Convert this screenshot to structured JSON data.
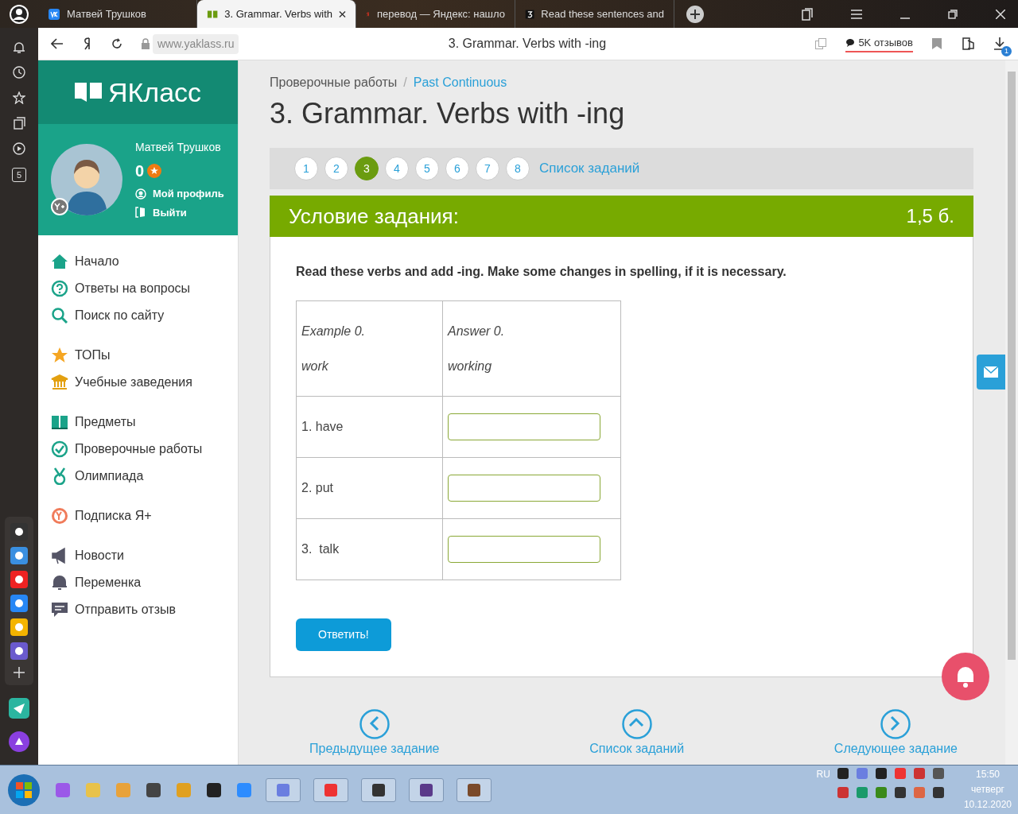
{
  "browser": {
    "tabs": [
      {
        "title": "Матвей Трушков",
        "selected": false
      },
      {
        "title": "3. Grammar. Verbs with",
        "selected": true
      },
      {
        "title": "перевод — Яндекс: нашло",
        "selected": false
      },
      {
        "title": "Read these sentences and",
        "selected": false
      }
    ],
    "url": "www.yaklass.ru",
    "page_title": "3. Grammar. Verbs with -ing",
    "reviews": "5K отзывов",
    "downloads_count": "1",
    "rail_badge": "5"
  },
  "site": {
    "logo": "ЯКласс",
    "user": {
      "name": "Матвей Трушков",
      "points": "0",
      "links": [
        {
          "label": "Мой профиль"
        },
        {
          "label": "Выйти"
        }
      ]
    },
    "menu": [
      {
        "items": [
          {
            "label": "Начало"
          },
          {
            "label": "Ответы на вопросы"
          },
          {
            "label": "Поиск по сайту"
          }
        ]
      },
      {
        "items": [
          {
            "label": "ТОПы"
          },
          {
            "label": "Учебные заведения"
          }
        ]
      },
      {
        "items": [
          {
            "label": "Предметы"
          },
          {
            "label": "Проверочные работы"
          },
          {
            "label": "Олимпиада"
          }
        ]
      },
      {
        "items": [
          {
            "label": "Подписка Я+"
          }
        ]
      },
      {
        "items": [
          {
            "label": "Новости"
          },
          {
            "label": "Переменка"
          },
          {
            "label": "Отправить отзыв"
          }
        ]
      }
    ]
  },
  "breadcrumbs": [
    {
      "label": "Проверочные работы"
    },
    {
      "label": "Past Continuous"
    }
  ],
  "breadcrumb_separator": "/",
  "title": "3. Grammar. Verbs with -ing",
  "pager": [
    {
      "label": "1",
      "selected": false
    },
    {
      "label": "2",
      "selected": false
    },
    {
      "label": "3",
      "selected": true
    },
    {
      "label": "4",
      "selected": false
    },
    {
      "label": "5",
      "selected": false
    },
    {
      "label": "6",
      "selected": false
    },
    {
      "label": "7",
      "selected": false
    },
    {
      "label": "8",
      "selected": false
    }
  ],
  "task_list_link": "Список заданий",
  "task": {
    "header": "Условие задания:",
    "points": "1,5 б.",
    "instruction": "Read these verbs and add -ing. Make some changes in spelling, if it is necessary.",
    "example": {
      "left": [
        "Example 0.",
        "work"
      ],
      "right": [
        "Answer 0.",
        "working"
      ]
    },
    "rows": [
      {
        "word": "1. have"
      },
      {
        "word": "2. put"
      },
      {
        "word": "3.  talk"
      }
    ],
    "submit": "Ответить!"
  },
  "bottom_nav": [
    {
      "label": "Предыдущее задание"
    },
    {
      "label": "Список заданий"
    },
    {
      "label": "Следующее задание"
    }
  ],
  "taskbar": {
    "lang": "RU",
    "time": "15:50",
    "day": "четверг",
    "date": "10.12.2020"
  }
}
